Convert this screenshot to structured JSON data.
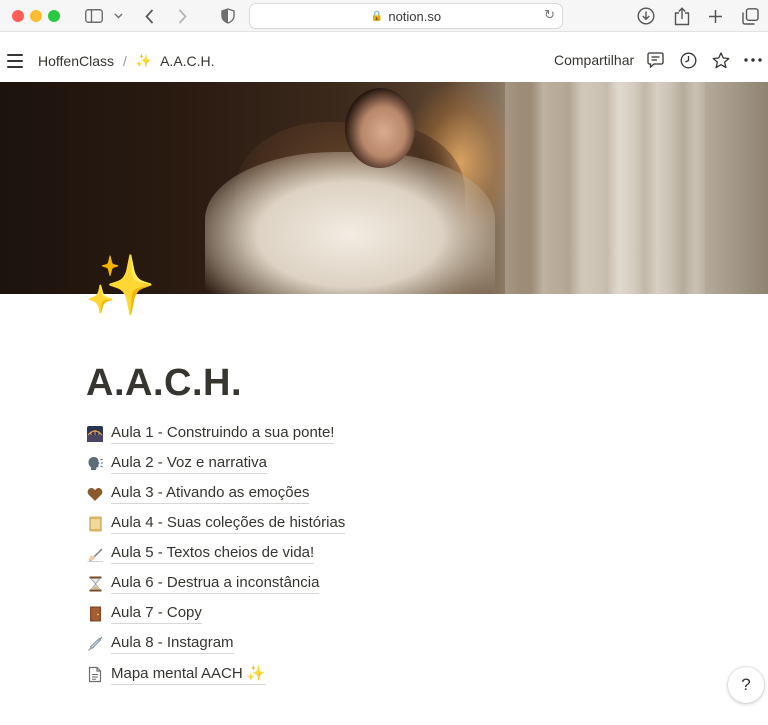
{
  "browser": {
    "url": "notion.so"
  },
  "breadcrumb": {
    "workspace": "HoffenClass",
    "page_emoji": "✨",
    "page": "A.A.C.H."
  },
  "topbar": {
    "share_label": "Compartilhar"
  },
  "page": {
    "icon": "✨",
    "title": "A.A.C.H."
  },
  "lessons": [
    {
      "icon": "bridge-icon",
      "label": "Aula 1 - Construindo a sua ponte!"
    },
    {
      "icon": "speaking-head-icon",
      "label": "Aula 2 - Voz e narrativa"
    },
    {
      "icon": "brown-heart-icon",
      "label": "Aula 3 - Ativando as emoções"
    },
    {
      "icon": "scroll-icon",
      "label": "Aula 4 - Suas coleções de histórias"
    },
    {
      "icon": "writing-hand-icon",
      "label": "Aula 5 - Textos cheios de vida!"
    },
    {
      "icon": "hourglass-icon",
      "label": "Aula 6 - Destrua a inconstância"
    },
    {
      "icon": "door-icon",
      "label": "Aula 7 - Copy"
    },
    {
      "icon": "syringe-icon",
      "label": "Aula 8 - Instagram"
    }
  ],
  "mind_map": {
    "icon": "page-icon",
    "label": "Mapa mental AACH",
    "emoji": "✨"
  },
  "help": {
    "label": "?"
  }
}
